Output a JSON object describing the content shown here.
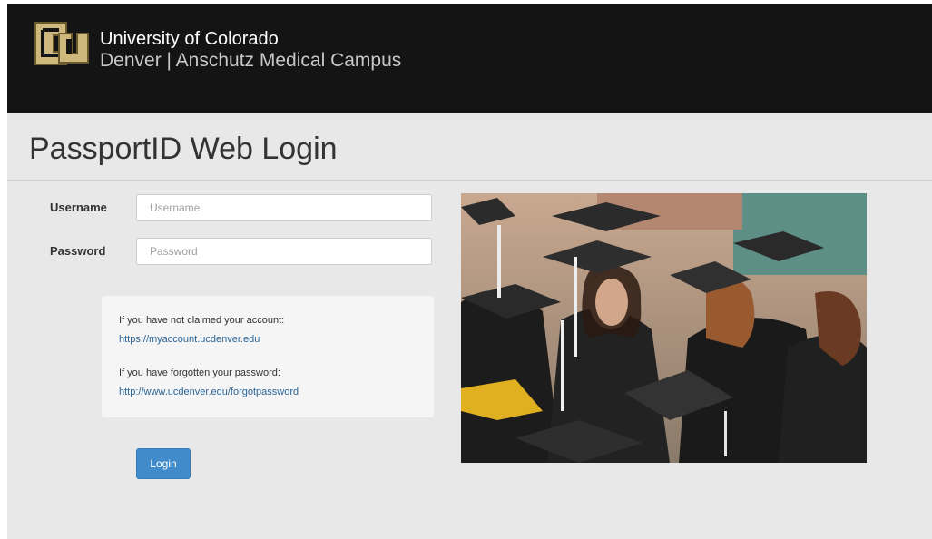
{
  "header": {
    "university": "University of Colorado",
    "campus": "Denver | Anschutz Medical Campus"
  },
  "page_title": "PassportID Web Login",
  "form": {
    "username_label": "Username",
    "username_placeholder": "Username",
    "username_value": "",
    "password_label": "Password",
    "password_placeholder": "Password",
    "password_value": "",
    "login_label": "Login"
  },
  "info": {
    "unclaimed_text": "If you have not claimed your account:",
    "unclaimed_link": "https://myaccount.ucdenver.edu",
    "forgot_text": "If you have forgotten your password:",
    "forgot_link": "http://www.ucdenver.edu/forgotpassword"
  },
  "colors": {
    "header_bg": "#141414",
    "page_bg": "#e8e8e8",
    "brand_gold": "#cfb87c",
    "link": "#2a6496",
    "button": "#428bca"
  },
  "icons": {
    "logo": "cu-logo-icon"
  }
}
